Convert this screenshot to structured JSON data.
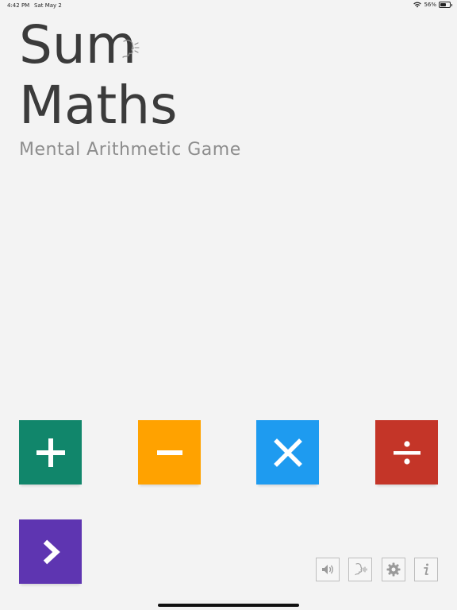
{
  "status_bar": {
    "time": "4:42 PM",
    "date": "Sat May 2",
    "battery": "56%",
    "battery_level": 0.56
  },
  "title": {
    "line1": "Sum",
    "line2": "Maths"
  },
  "subtitle": "Mental Arithmetic Game",
  "operations": [
    {
      "symbol": "+",
      "icon": "plus-icon",
      "color": "#11866b"
    },
    {
      "symbol": "−",
      "icon": "minus-icon",
      "color": "#ffa200"
    },
    {
      "symbol": "×",
      "icon": "multiply-icon",
      "color": "#1e9bf0"
    },
    {
      "symbol": "÷",
      "icon": "divide-icon",
      "color": "#c43528"
    }
  ],
  "start_button": {
    "icon": "chevron-right-icon",
    "color": "#5e35b1"
  },
  "toolbar": [
    {
      "icon": "speaker-icon"
    },
    {
      "icon": "voice-icon"
    },
    {
      "icon": "gear-icon"
    },
    {
      "icon": "info-icon"
    }
  ],
  "colors": {
    "background": "#f3f3f3",
    "title": "#3b3b3b",
    "subtitle": "#8d8d8d"
  }
}
